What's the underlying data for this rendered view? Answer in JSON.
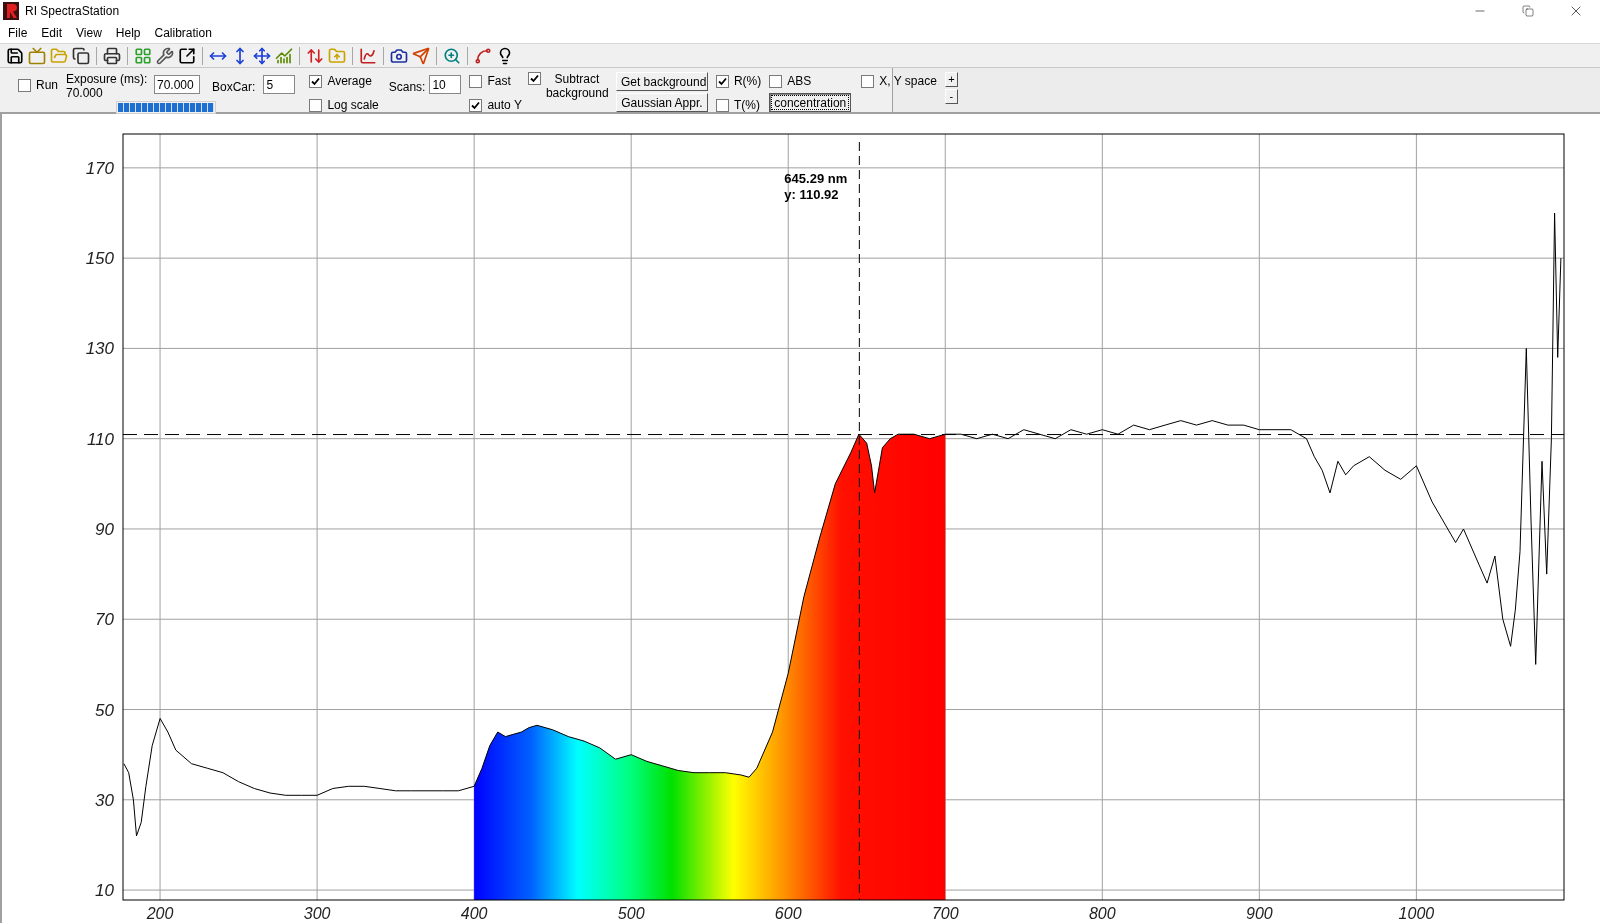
{
  "window": {
    "title": "RI SpectraStation"
  },
  "menu": [
    "File",
    "Edit",
    "View",
    "Help",
    "Calibration"
  ],
  "controls": {
    "run": {
      "label": "Run",
      "checked": false
    },
    "exposure": {
      "label": "Exposure (ms):",
      "reading": "70.000",
      "value": "70.000",
      "level": 1
    },
    "boxcar": {
      "label": "BoxCar:",
      "value": "5"
    },
    "average": {
      "label": "Average",
      "checked": true
    },
    "log_scale": {
      "label": "Log scale",
      "checked": false
    },
    "scans": {
      "label": "Scans:",
      "value": "10"
    },
    "fast": {
      "label": "Fast",
      "checked": false
    },
    "auto_y": {
      "label": "auto Y",
      "checked": true
    },
    "subtract_background": {
      "label": "Subtract background",
      "checked": true
    },
    "get_background": {
      "label": "Get background",
      "pressed": false
    },
    "gaussian": {
      "label": "Gaussian Appr.",
      "pressed": false
    },
    "r_percent": {
      "label": "R(%)",
      "checked": true
    },
    "t_percent": {
      "label": "T(%)",
      "checked": false
    },
    "abs": {
      "label": "ABS",
      "checked": false
    },
    "concentration": {
      "label": "concentration",
      "pressed": true
    },
    "xy_space": {
      "label": "X, Y space",
      "checked": false
    },
    "zoom_in": "+",
    "zoom_out": "-"
  },
  "chart": {
    "chart_data": {
      "type": "line",
      "xlim": [
        176.4,
        1094
      ],
      "ylim": [
        7.8,
        177.5
      ],
      "xticks": [
        200,
        300,
        400,
        500,
        600,
        700,
        800,
        900,
        1000
      ],
      "yticks": [
        10,
        30,
        50,
        70,
        90,
        110,
        130,
        150,
        170
      ],
      "grid": true,
      "series": [
        {
          "color": "#000000",
          "x": [
            177,
            180,
            183,
            185,
            188,
            191,
            195,
            200,
            205,
            210,
            220,
            230,
            240,
            250,
            260,
            270,
            280,
            290,
            300,
            310,
            320,
            330,
            340,
            350,
            360,
            370,
            380,
            390,
            400,
            405,
            410,
            415,
            420,
            425,
            430,
            435,
            440,
            450,
            460,
            470,
            480,
            490,
            500,
            510,
            520,
            530,
            540,
            550,
            560,
            570,
            575,
            580,
            590,
            600,
            610,
            620,
            630,
            640,
            645,
            650,
            653,
            655,
            658,
            660,
            665,
            670,
            680,
            690,
            700,
            710,
            720,
            730,
            740,
            750,
            760,
            770,
            780,
            790,
            800,
            810,
            820,
            830,
            840,
            850,
            860,
            870,
            880,
            890,
            900,
            910,
            920,
            930,
            935,
            940,
            945,
            950,
            955,
            960,
            970,
            980,
            990,
            1000,
            1010,
            1020,
            1025,
            1030,
            1040,
            1045,
            1050,
            1055,
            1060,
            1063,
            1066,
            1070,
            1073,
            1076,
            1080,
            1083,
            1086,
            1088,
            1090,
            1092
          ],
          "values": [
            38,
            36,
            30,
            22,
            25,
            33,
            42,
            48,
            45,
            41,
            38,
            37,
            36,
            34,
            32.5,
            31.5,
            31,
            31,
            31,
            32.5,
            33,
            33,
            32.5,
            32,
            32,
            32,
            32,
            32,
            33,
            37,
            42,
            45,
            44,
            44.5,
            45,
            46,
            46.5,
            45.5,
            44,
            43,
            41.5,
            39,
            40,
            38.5,
            37.5,
            36.5,
            36,
            36,
            36,
            35.5,
            35,
            37,
            45,
            58,
            75,
            88,
            100,
            107,
            111,
            109,
            104,
            98,
            104,
            108,
            110,
            111,
            111,
            110,
            111,
            111,
            110,
            111,
            110,
            112,
            111,
            110,
            112,
            111,
            112,
            111,
            113,
            112,
            113,
            114,
            113,
            114,
            113,
            113,
            112,
            112,
            112,
            110,
            106,
            103,
            98,
            105,
            102,
            104,
            106,
            103,
            101,
            104,
            96,
            90,
            87,
            90,
            82,
            78,
            84,
            70,
            64,
            72,
            85,
            130,
            92,
            60,
            105,
            80,
            110,
            160,
            128,
            150
          ]
        }
      ],
      "ref_lines": [
        {
          "axis": "x",
          "value": 645.29
        },
        {
          "axis": "y",
          "value": 110.92
        }
      ],
      "annotations": [
        "645.29 nm",
        "y: 110.92"
      ]
    }
  }
}
